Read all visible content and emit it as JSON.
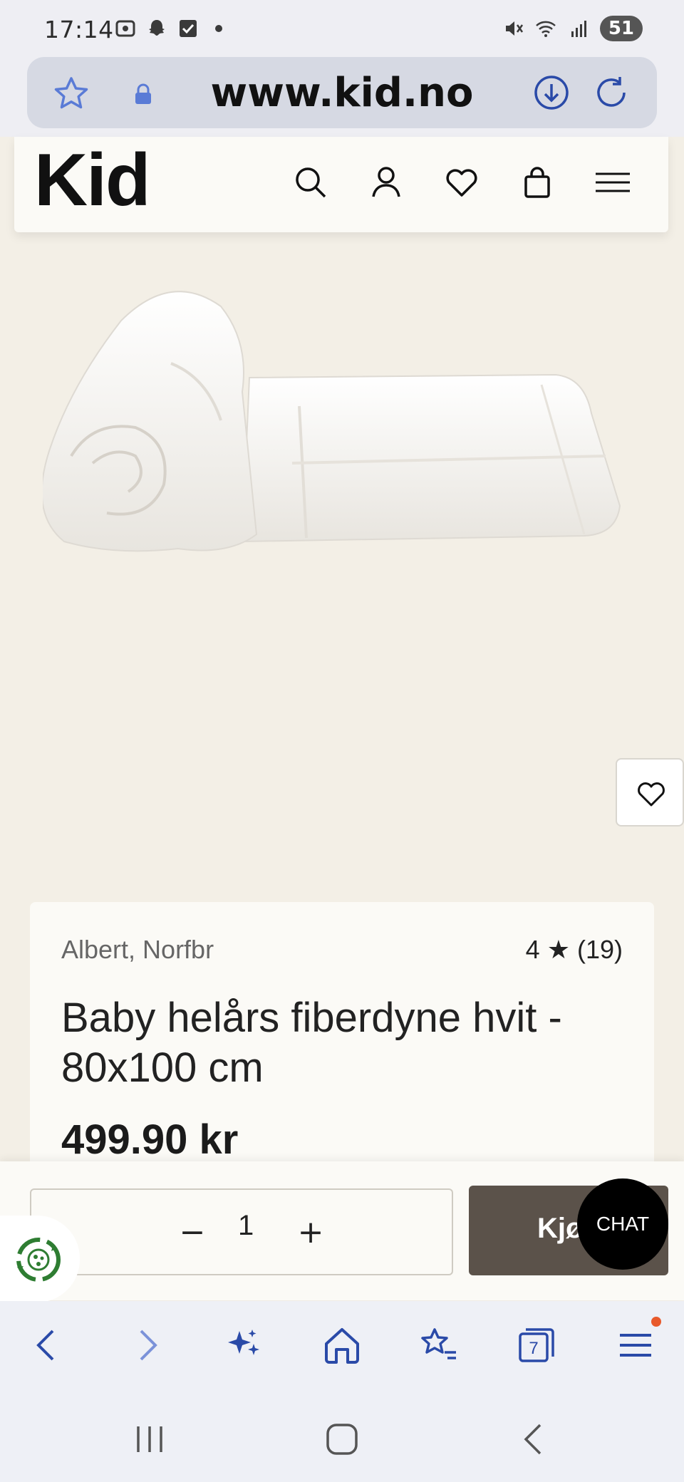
{
  "status_bar": {
    "time": "17:14",
    "battery": "51",
    "left_icons": [
      "screenshot-icon",
      "snapchat-icon",
      "checkbox-icon",
      "dot-icon"
    ],
    "right_icons": [
      "mute-icon",
      "wifi-icon",
      "signal-icon",
      "battery-icon"
    ]
  },
  "browser": {
    "url": "www.kid.no",
    "nav_items": [
      "back",
      "forward",
      "ai-assistant",
      "home",
      "bookmarks",
      "tabs",
      "menu"
    ],
    "tab_count": "7"
  },
  "site": {
    "logo": "Kid",
    "header_icons": [
      "search-icon",
      "account-icon",
      "wishlist-icon",
      "cart-icon",
      "menu-icon"
    ]
  },
  "product": {
    "brand": "Albert, Norfbr",
    "rating": "4 ★ (19)",
    "title": "Baby helårs fiberdyne hvit - 80x100 cm",
    "price": "499.90 kr"
  },
  "buy_bar": {
    "quantity_minus": "−",
    "quantity": "1",
    "quantity_plus": "+",
    "buy_label": "Kjøp",
    "chat_label": "CHAT"
  },
  "colors": {
    "page_bg": "#f3efe6",
    "buy_button": "#5b524a",
    "browser_accent": "#2a4aa8",
    "notification_dot": "#e8592b",
    "eco_green": "#2e7d32"
  }
}
